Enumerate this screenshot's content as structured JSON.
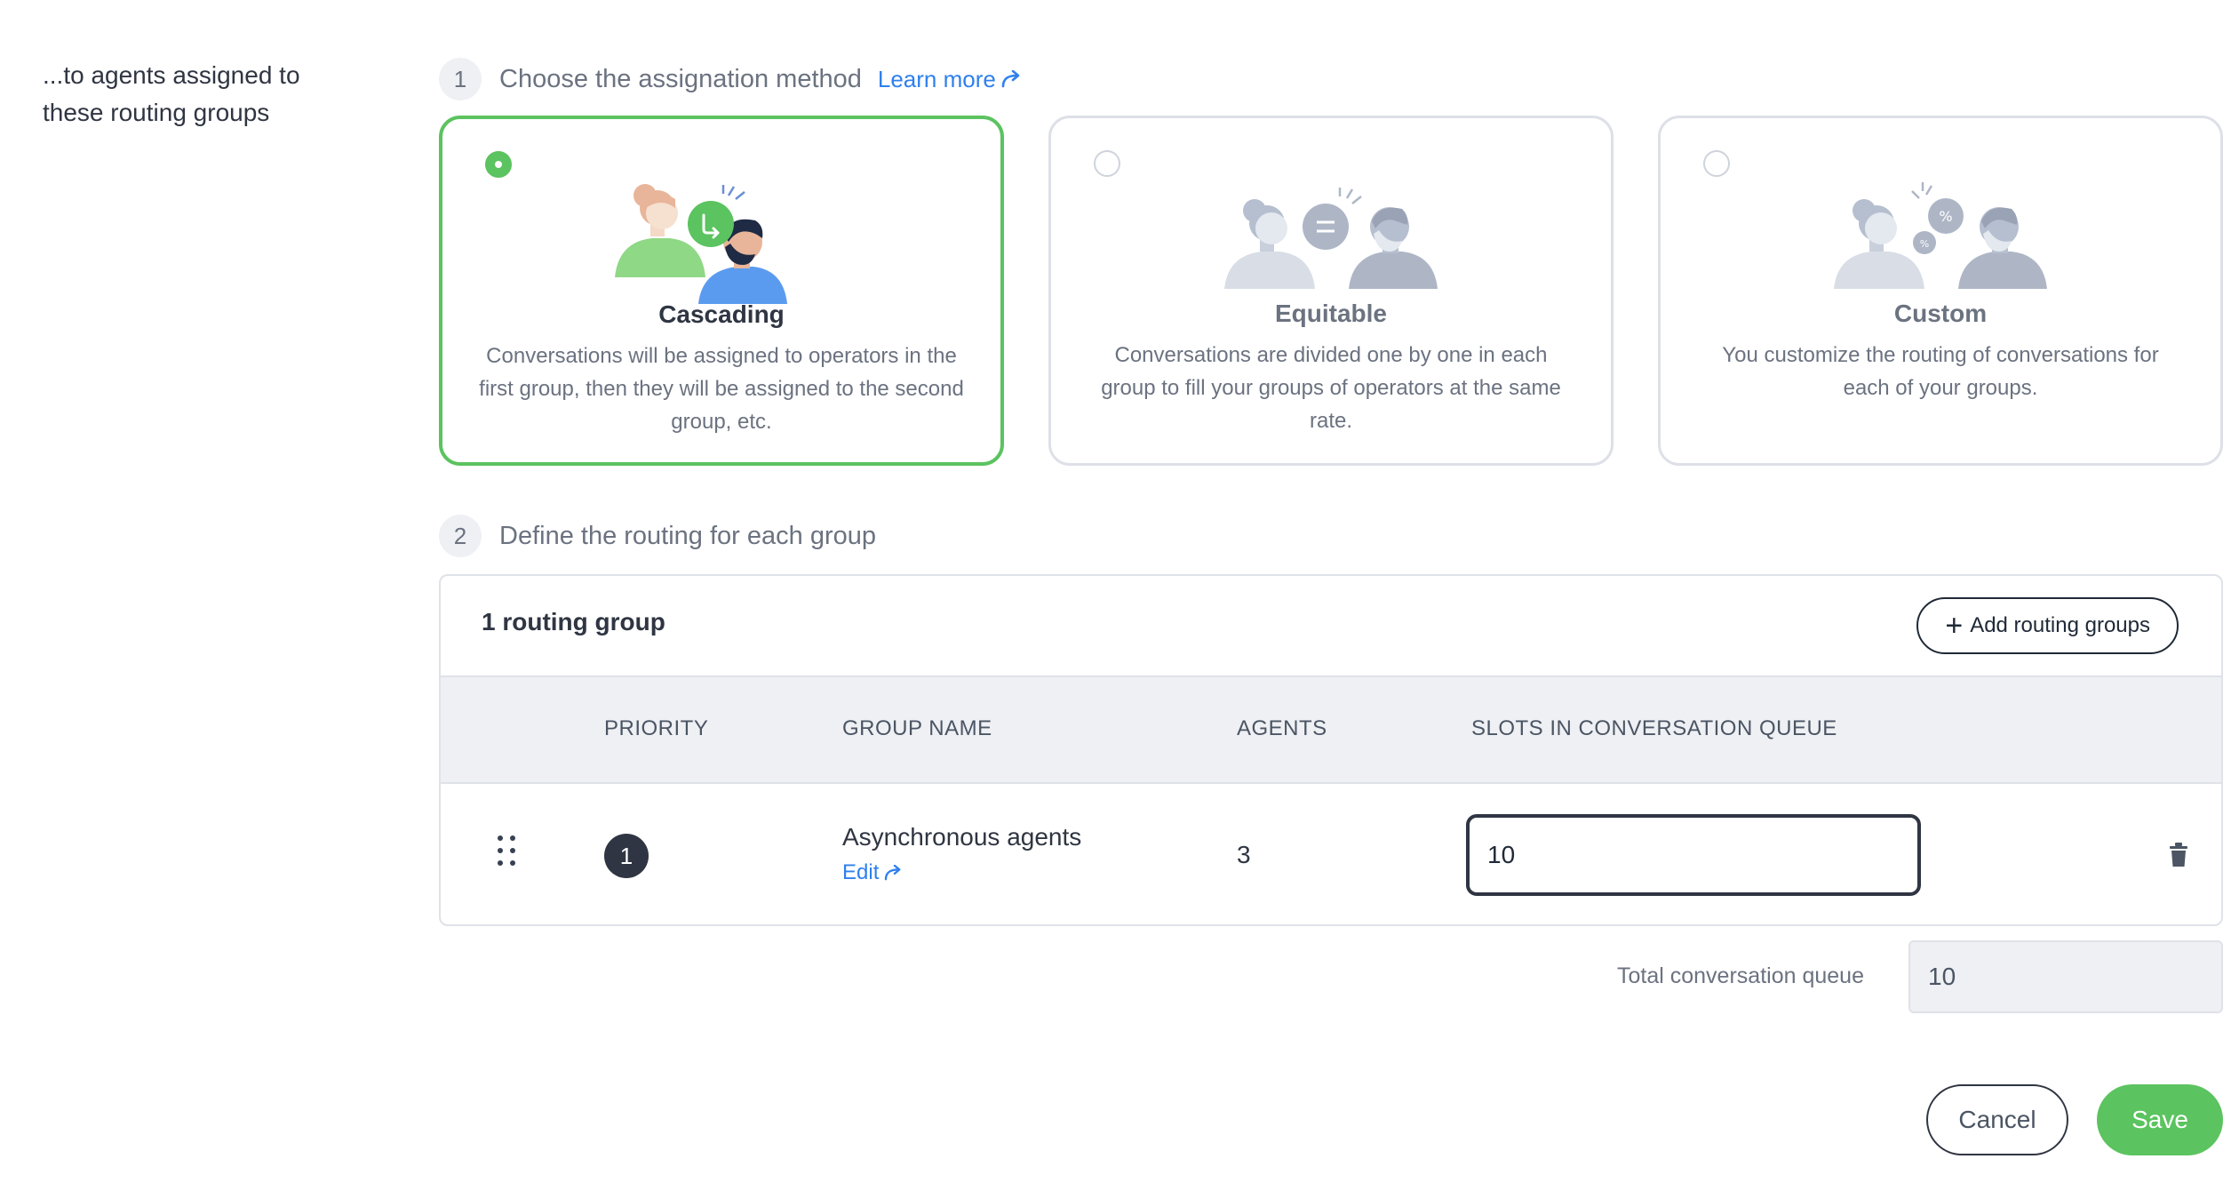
{
  "side_label": "...to agents assigned to these routing groups",
  "step1": {
    "number": "1",
    "text": "Choose the assignation method",
    "learn_more": "Learn more"
  },
  "methods": [
    {
      "title": "Cascading",
      "description": "Conversations will be assigned to operators in the first group, then they will be assigned to the second group, etc.",
      "selected": true
    },
    {
      "title": "Equitable",
      "description": "Conversations are divided one by one in each group to fill your groups of operators at the same rate.",
      "selected": false
    },
    {
      "title": "Custom",
      "description": "You customize the routing of conversations for each of your groups.",
      "selected": false
    }
  ],
  "step2": {
    "number": "2",
    "text": "Define the routing for each group"
  },
  "routing": {
    "count_label": "1 routing group",
    "add_button": "Add routing groups",
    "columns": [
      "PRIORITY",
      "GROUP NAME",
      "AGENTS",
      "SLOTS IN CONVERSATION QUEUE"
    ],
    "rows": [
      {
        "priority": "1",
        "group_name": "Asynchronous agents",
        "edit_label": "Edit",
        "agents": "3",
        "slots": "10"
      }
    ]
  },
  "total": {
    "label": "Total conversation queue",
    "value": "10"
  },
  "actions": {
    "cancel": "Cancel",
    "save": "Save"
  },
  "colors": {
    "accent_green": "#5bc35f",
    "link_blue": "#2f80ed",
    "dark": "#2f3542"
  }
}
